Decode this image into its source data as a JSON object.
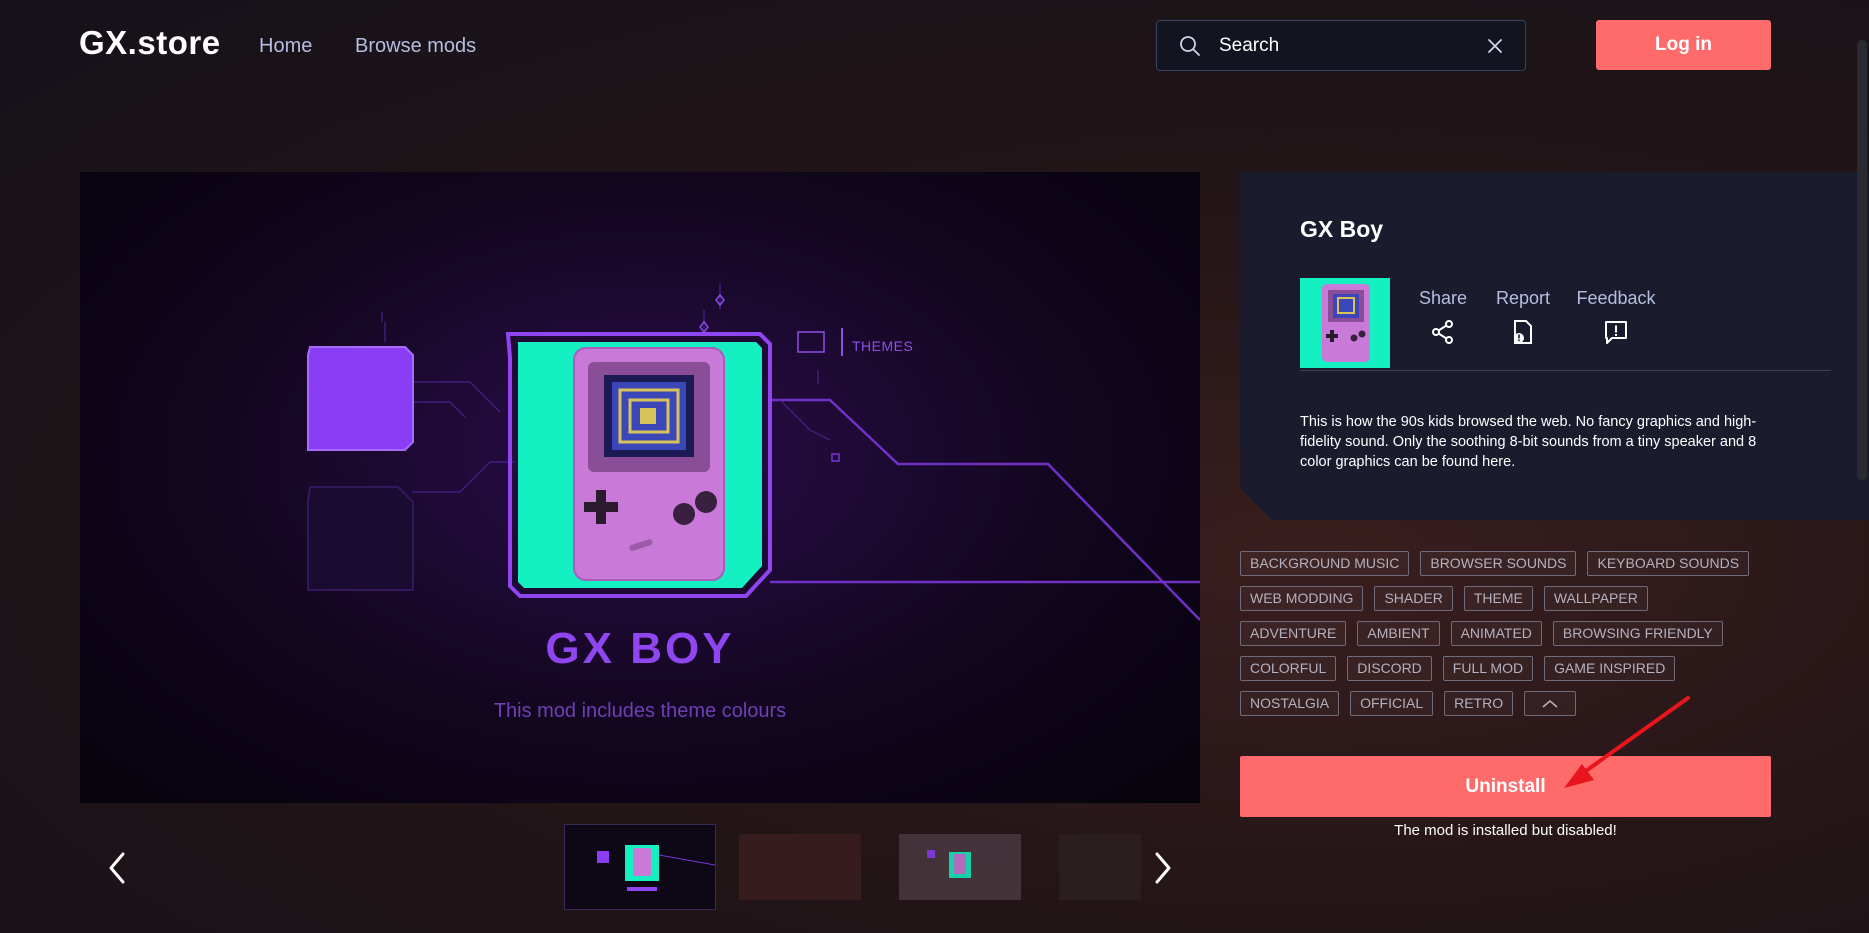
{
  "header": {
    "logo": "GX.store",
    "nav": {
      "home": "Home",
      "browse": "Browse mods"
    },
    "search": {
      "placeholder": "Search",
      "value": ""
    },
    "login_label": "Log in"
  },
  "hero": {
    "title": "GX BOY",
    "subtitle": "This mod includes theme colours",
    "themes_label": "THEMES"
  },
  "mod": {
    "title": "GX Boy",
    "actions": {
      "share": "Share",
      "report": "Report",
      "feedback": "Feedback"
    },
    "description": "This is how the 90s kids browsed the web. No fancy graphics and high-fidelity sound. Only the soothing 8-bit sounds from a tiny speaker and 8 color graphics can be found here."
  },
  "tags": {
    "row1": [
      "BACKGROUND MUSIC",
      "BROWSER SOUNDS",
      "KEYBOARD SOUNDS"
    ],
    "row2": [
      "WEB MODDING",
      "SHADER",
      "THEME",
      "WALLPAPER"
    ],
    "row3": [
      "ADVENTURE",
      "AMBIENT",
      "ANIMATED",
      "BROWSING FRIENDLY"
    ],
    "row4": [
      "COLORFUL",
      "DISCORD",
      "FULL MOD",
      "GAME INSPIRED"
    ],
    "row5": [
      "NOSTALGIA",
      "OFFICIAL",
      "RETRO"
    ]
  },
  "install": {
    "button_label": "Uninstall",
    "status": "The mod is installed but disabled!"
  },
  "colors": {
    "accent": "#ff6b6b",
    "purple": "#8f46f0",
    "mint": "#15f0c2",
    "gameboy_pink": "#c97ad9"
  },
  "icons": {
    "search": "search-icon",
    "clear": "close-icon",
    "share": "share-icon",
    "report": "report-icon",
    "feedback": "feedback-icon",
    "prev": "chevron-left-icon",
    "next": "chevron-right-icon",
    "collapse": "chevron-up-icon"
  }
}
